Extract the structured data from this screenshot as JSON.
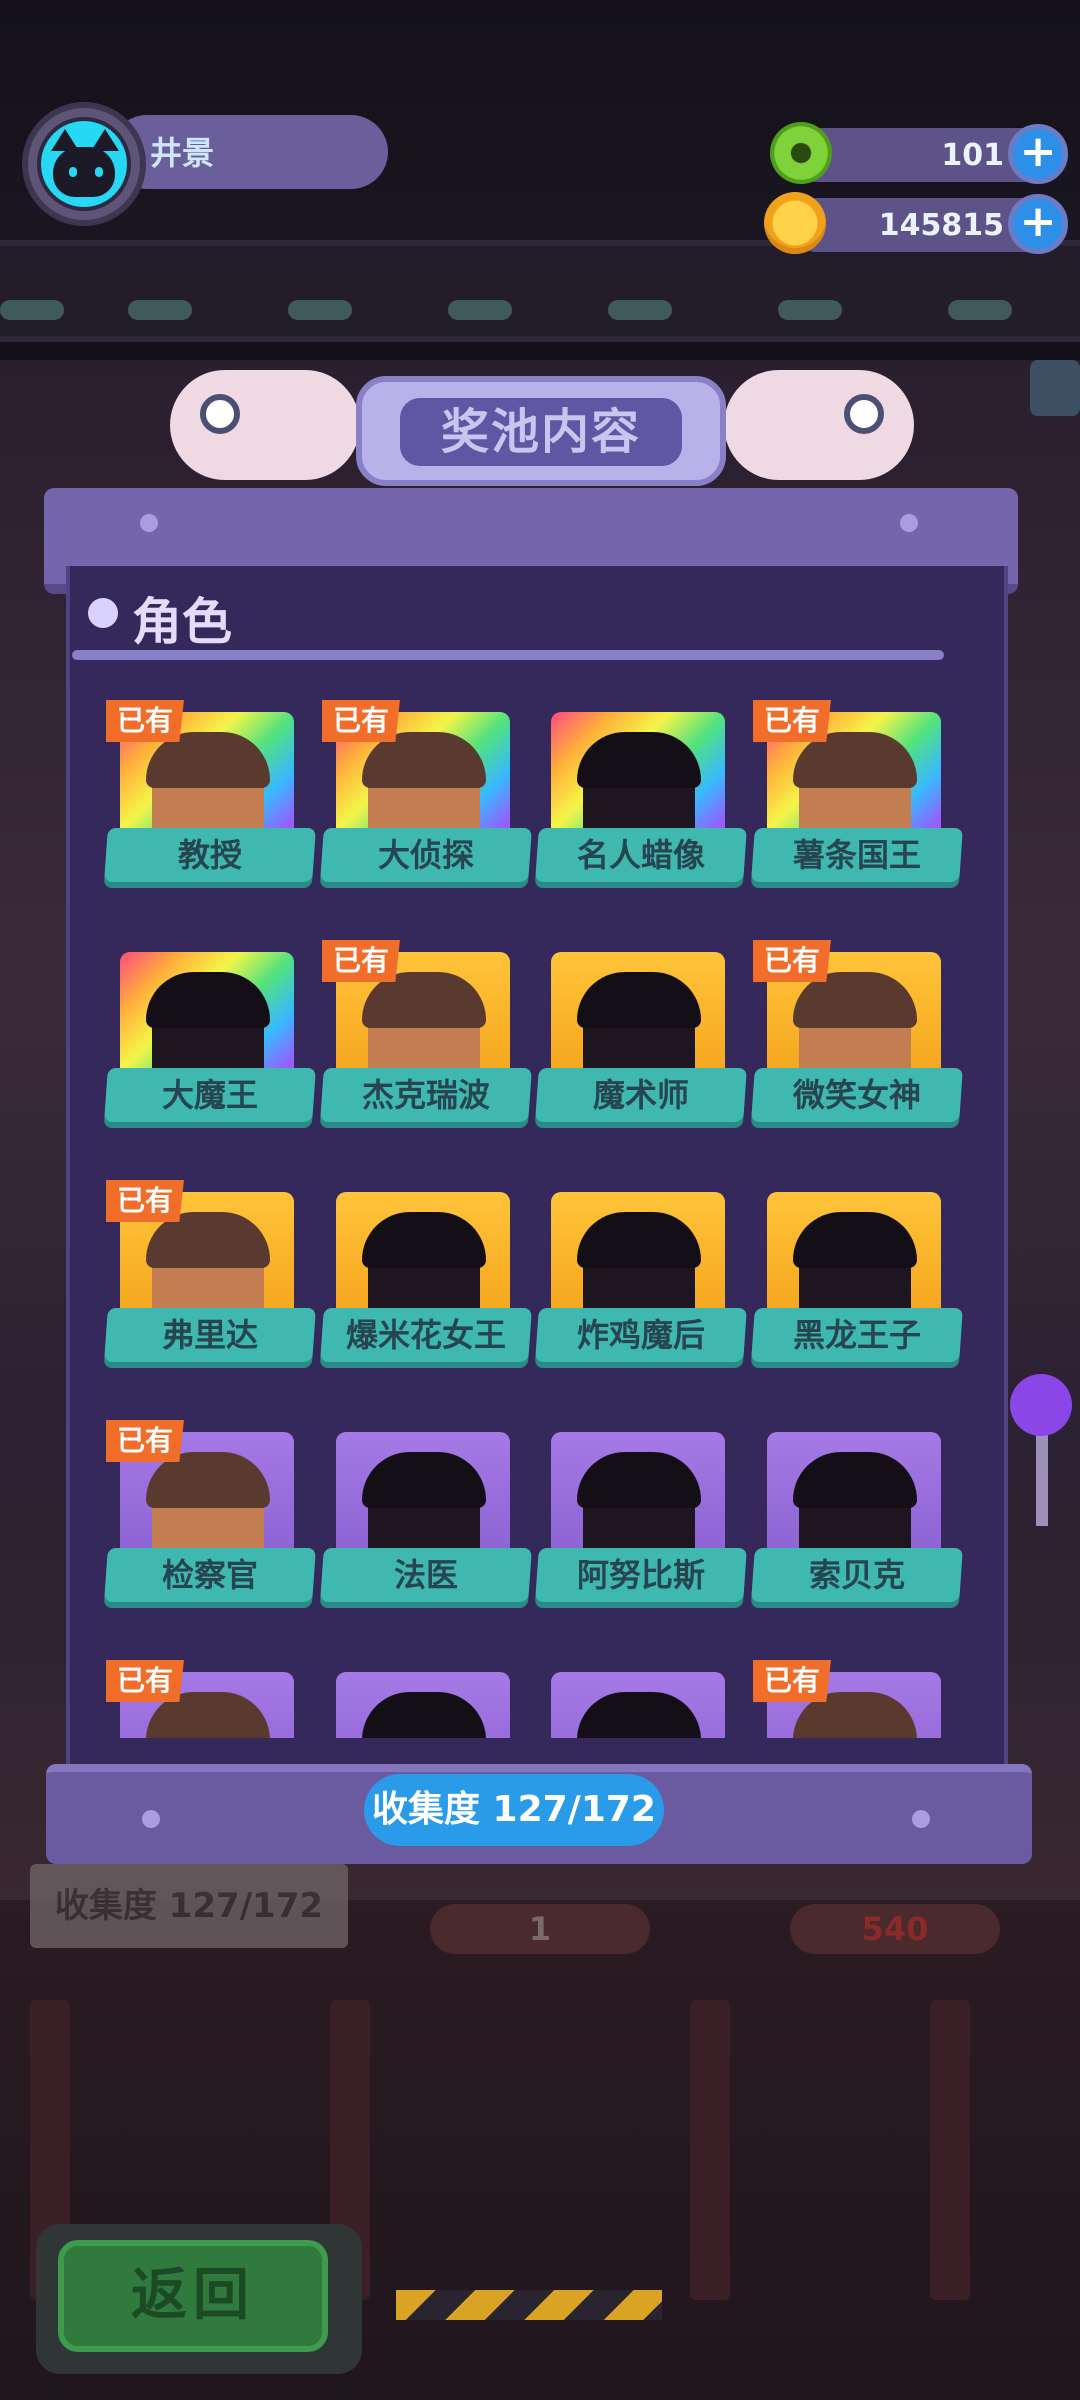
{
  "player": {
    "name": "井景"
  },
  "currencies": [
    {
      "icon": "green-donut-icon",
      "value": "101"
    },
    {
      "icon": "gold-planet-coin-icon",
      "value": "145815"
    }
  ],
  "panel": {
    "title": "奖池内容",
    "section_title": "角色",
    "owned_badge": "已有",
    "collection": "收集度  127/172"
  },
  "characters": [
    {
      "name": "教授",
      "owned": true,
      "rarity": "rainbow"
    },
    {
      "name": "大侦探",
      "owned": true,
      "rarity": "rainbow"
    },
    {
      "name": "名人蜡像",
      "owned": false,
      "rarity": "rainbow"
    },
    {
      "name": "薯条国王",
      "owned": true,
      "rarity": "rainbow"
    },
    {
      "name": "大魔王",
      "owned": false,
      "rarity": "rainbow"
    },
    {
      "name": "杰克瑞波",
      "owned": true,
      "rarity": "gold"
    },
    {
      "name": "魔术师",
      "owned": false,
      "rarity": "gold"
    },
    {
      "name": "微笑女神",
      "owned": true,
      "rarity": "gold"
    },
    {
      "name": "弗里达",
      "owned": true,
      "rarity": "gold"
    },
    {
      "name": "爆米花女王",
      "owned": false,
      "rarity": "gold"
    },
    {
      "name": "炸鸡魔后",
      "owned": false,
      "rarity": "gold"
    },
    {
      "name": "黑龙王子",
      "owned": false,
      "rarity": "gold"
    },
    {
      "name": "检察官",
      "owned": true,
      "rarity": "purple"
    },
    {
      "name": "法医",
      "owned": false,
      "rarity": "purple"
    },
    {
      "name": "阿努比斯",
      "owned": false,
      "rarity": "purple"
    },
    {
      "name": "索贝克",
      "owned": false,
      "rarity": "purple"
    },
    {
      "name": "",
      "owned": true,
      "rarity": "purple"
    },
    {
      "name": "",
      "owned": false,
      "rarity": "purple"
    },
    {
      "name": "",
      "owned": false,
      "rarity": "purple"
    },
    {
      "name": "",
      "owned": true,
      "rarity": "purple"
    }
  ],
  "background": {
    "collection_sign": "收集度  127/172",
    "counter_left": "1",
    "counter_right": "540"
  },
  "back_button": "返回",
  "colors": {
    "accent": "#2a9be8",
    "owned_badge": "#f06d2a",
    "label": "#3fb8b0",
    "panel": "#35285b"
  }
}
